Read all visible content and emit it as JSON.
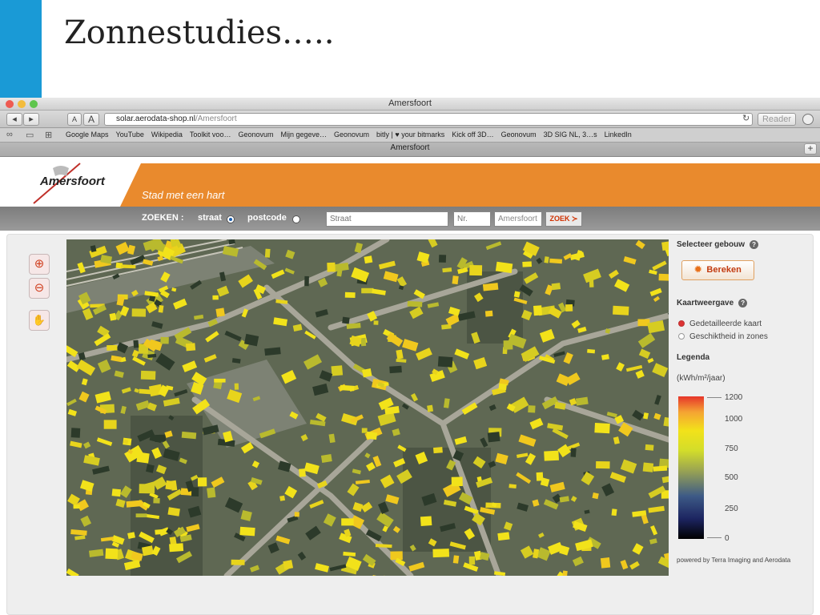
{
  "slide": {
    "title": "Zonnestudies….."
  },
  "browser": {
    "window_title": "Amersfoort",
    "url_host": "solar.aerodata-shop.nl",
    "url_path": "/Amersfoort",
    "reader_label": "Reader",
    "tab_title": "Amersfoort",
    "nav_back": "◂",
    "nav_forward": "▸",
    "font_small": "A",
    "font_large": "A",
    "bookmarks": [
      "Google Maps",
      "YouTube",
      "Wikipedia",
      "Toolkit voo…",
      "Geonovum",
      "Mijn gegeve…",
      "Geonovum",
      "bitly | ♥ your bitmarks",
      "Kick off 3D…",
      "Geonovum",
      "3D SIG NL, 3…s",
      "LinkedIn"
    ]
  },
  "site": {
    "logo": "Amersfoort",
    "slogan": "Stad met een hart",
    "search": {
      "label": "ZOEKEN :",
      "opt_street": "straat",
      "opt_postcode": "postcode",
      "street_placeholder": "Straat",
      "number_placeholder": "Nr.",
      "city_value": "Amersfoort",
      "submit_label": "ZOEK ≻"
    }
  },
  "panel": {
    "select_title": "Selecteer gebouw",
    "calc_label": "Bereken",
    "view_title": "Kaartweergave",
    "view_options": [
      "Gedetailleerde kaart",
      "Geschiktheid in zones"
    ],
    "legend_title": "Legenda",
    "legend_unit": "(kWh/m²/jaar)",
    "legend_ticks": [
      "1200",
      "1000",
      "750",
      "500",
      "250",
      "0"
    ],
    "credit": "powered by Terra Imaging and Aerodata"
  },
  "colors": {
    "accent": "#1a9ad6",
    "banner": "#e98a2d",
    "roof_high": "#f2e21a",
    "roof_max": "#e6352a"
  }
}
